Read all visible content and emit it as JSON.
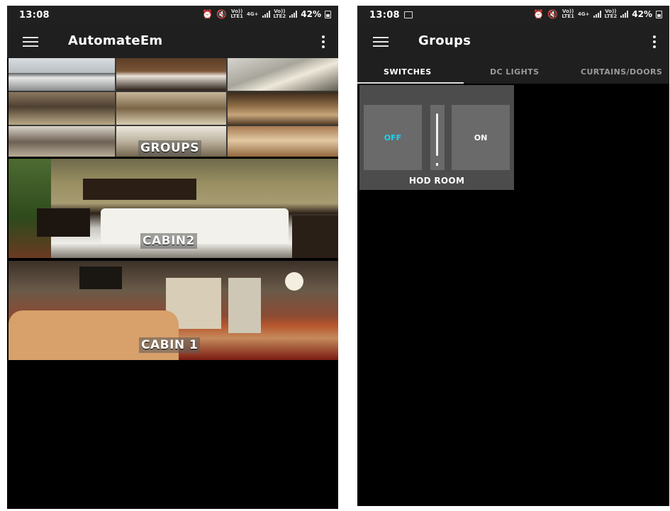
{
  "left_screen": {
    "status_bar": {
      "time": "13:08",
      "net_left": "Vo))",
      "net_left_sub": "LTE1",
      "net_mid": "4G+",
      "net_right": "Vo))",
      "net_right_sub": "LTE2",
      "battery": "42%"
    },
    "app_bar": {
      "title": "AutomateEm",
      "menu_icon": "hamburger-menu-icon",
      "overflow_icon": "more-vert-icon"
    },
    "tiles": [
      {
        "label": "GROUPS"
      },
      {
        "label": "CABIN2"
      },
      {
        "label": "CABIN 1"
      }
    ]
  },
  "right_screen": {
    "status_bar": {
      "time": "13:08",
      "net_left": "Vo))",
      "net_left_sub": "LTE1",
      "net_mid": "4G+",
      "net_right": "Vo))",
      "net_right_sub": "LTE2",
      "battery": "42%"
    },
    "app_bar": {
      "title": "Groups",
      "menu_icon": "hamburger-menu-icon",
      "overflow_icon": "more-vert-icon"
    },
    "tabs": [
      {
        "label": "SWITCHES",
        "selected": true
      },
      {
        "label": "DC LIGHTS",
        "selected": false
      },
      {
        "label": "CURTAINS/DOORS",
        "selected": false
      }
    ],
    "switch_card": {
      "off_label": "OFF",
      "on_label": "ON",
      "name": "HOD ROOM"
    }
  },
  "colors": {
    "off_accent": "#19d3f0",
    "app_bar": "#1f1f1f",
    "background": "#000000",
    "card": "#4c4c4c"
  }
}
